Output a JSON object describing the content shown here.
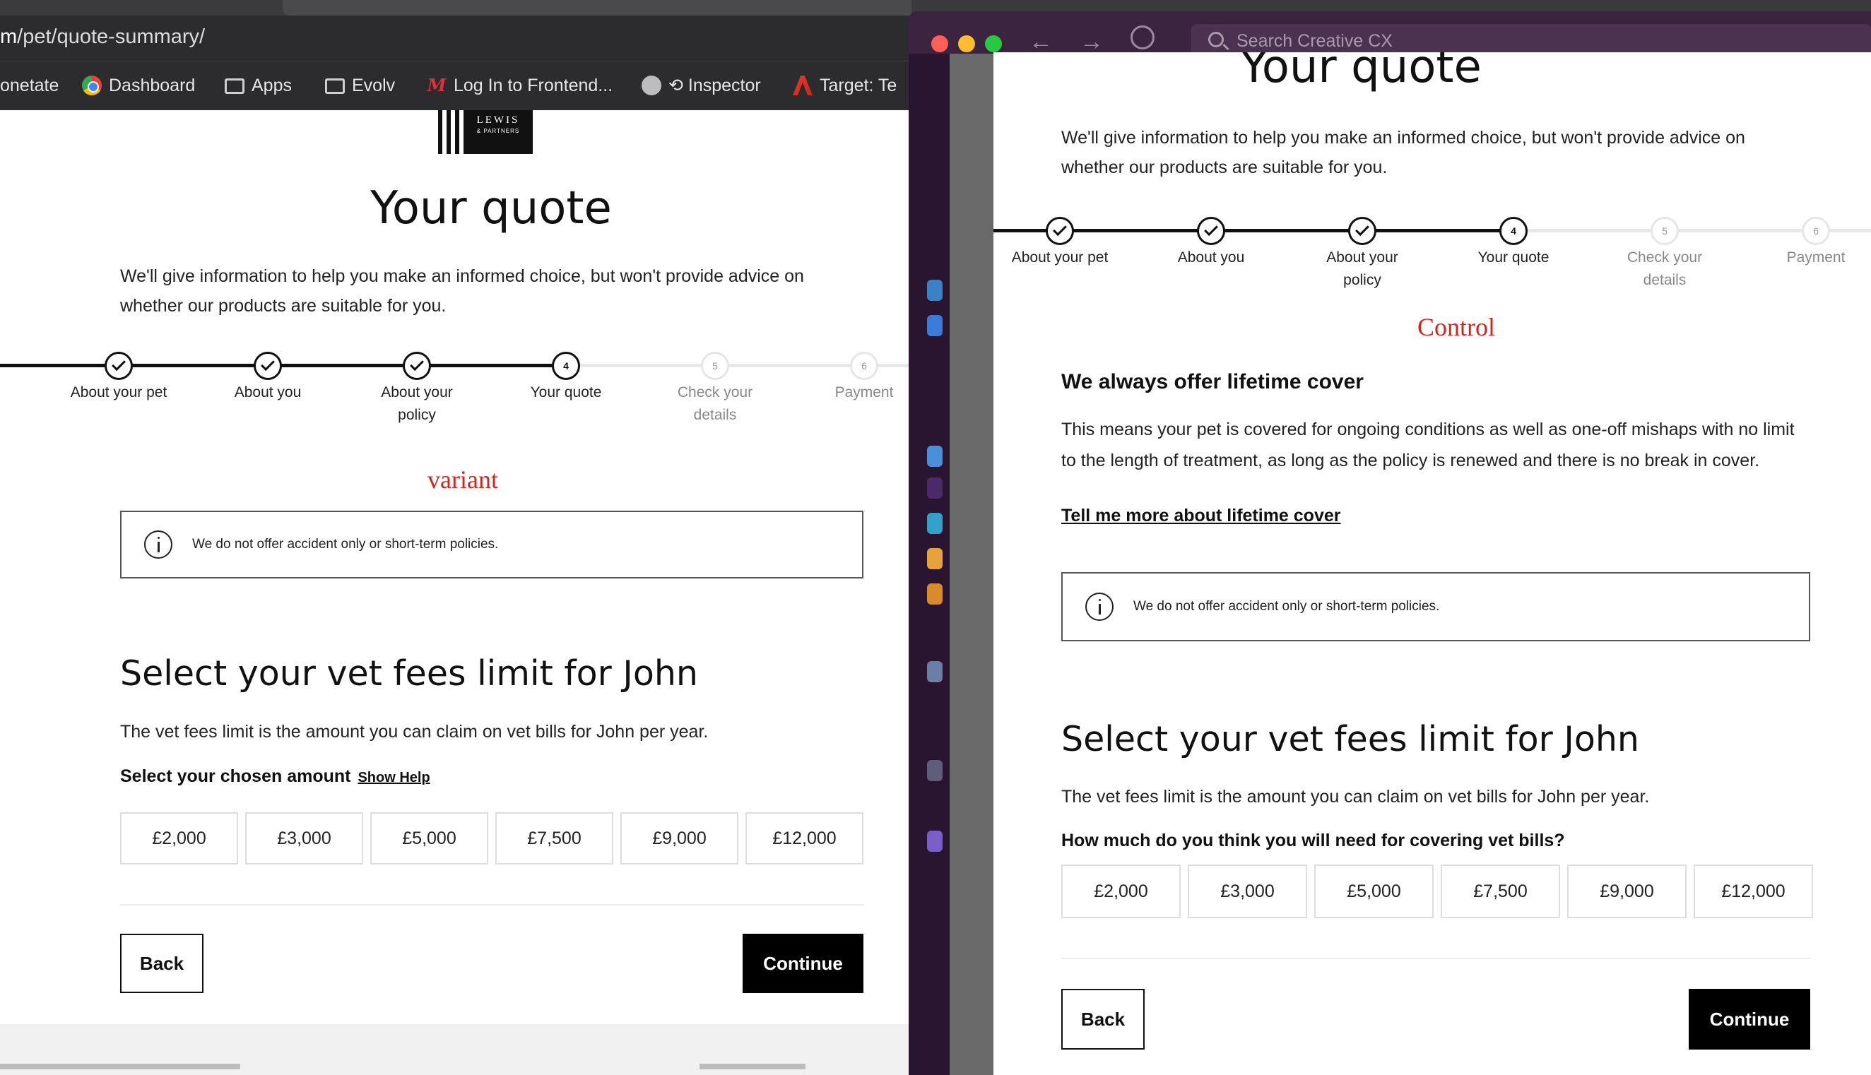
{
  "left_window": {
    "url_prefix": "m",
    "url_path": "/pet/quote-summary/",
    "bookmarks": [
      {
        "icon": "none",
        "label": "onetate"
      },
      {
        "icon": "chrome-icon",
        "label": "Dashboard"
      },
      {
        "icon": "folder-icon",
        "label": "Apps"
      },
      {
        "icon": "folder-icon",
        "label": "Evolv"
      },
      {
        "icon": "m-logo-icon",
        "label": "Log In to Frontend..."
      },
      {
        "icon": "globe-icon",
        "label": "⟲ Inspector"
      },
      {
        "icon": "adobe-icon",
        "label": "Target: Te"
      }
    ],
    "logo": {
      "line1": "LEWIS",
      "line2": "& PARTNERS"
    },
    "title": "Your quote",
    "intro": "We'll give information to help you make an informed choice, but won't provide advice on whether our products are suitable for you.",
    "steps": [
      {
        "number": "1",
        "label": "About your pet",
        "state": "done"
      },
      {
        "number": "2",
        "label": "About you",
        "state": "done"
      },
      {
        "number": "3",
        "label": "About your policy",
        "state": "done"
      },
      {
        "number": "4",
        "label": "Your quote",
        "state": "current"
      },
      {
        "number": "5",
        "label": "Check your details",
        "state": "todo"
      },
      {
        "number": "6",
        "label": "Payment",
        "state": "todo"
      }
    ],
    "variant_tag": "variant",
    "info_text": "We do not offer accident only or short-term policies.",
    "section_title": "Select your vet fees limit for John",
    "section_desc": "The vet fees limit is the amount you can claim on vet bills for John per year.",
    "ask_label": "Select your chosen amount",
    "help_link": "Show Help",
    "amounts": [
      "£2,000",
      "£3,000",
      "£5,000",
      "£7,500",
      "£9,000",
      "£12,000"
    ],
    "back_label": "Back",
    "continue_label": "Continue"
  },
  "right_window": {
    "search_placeholder": "Search Creative CX",
    "title": "Your quote",
    "intro": "We'll give information to help you make an informed choice, but won't provide advice on whether our products are suitable for you.",
    "steps": [
      {
        "number": "1",
        "label": "About your pet",
        "state": "done"
      },
      {
        "number": "2",
        "label": "About you",
        "state": "done"
      },
      {
        "number": "3",
        "label": "About your policy",
        "state": "done"
      },
      {
        "number": "4",
        "label": "Your quote",
        "state": "current"
      },
      {
        "number": "5",
        "label": "Check your details",
        "state": "todo"
      },
      {
        "number": "6",
        "label": "Payment",
        "state": "todo"
      }
    ],
    "control_tag": "Control",
    "lifetime_title": "We always offer lifetime cover",
    "lifetime_desc": "This means your pet is covered for ongoing conditions as well as one-off mishaps with no limit to the length of treatment, as long as the policy is renewed and there is no break in cover.",
    "lifetime_link": "Tell me more about lifetime cover",
    "info_text": "We do not offer accident only or short-term policies.",
    "section_title": "Select your vet fees limit for John",
    "section_desc": "The vet fees limit is the amount you can claim on vet bills for John per year.",
    "ask_label": "How much do you think you will need for covering vet bills?",
    "amounts": [
      "£2,000",
      "£3,000",
      "£5,000",
      "£7,500",
      "£9,000",
      "£12,000"
    ],
    "back_label": "Back",
    "continue_label": "Continue"
  },
  "colors": {
    "accent_red": "#d3251c",
    "primary_black": "#000000",
    "step_inactive": "#e8e8e8",
    "slack_purple": "#3a2440"
  }
}
